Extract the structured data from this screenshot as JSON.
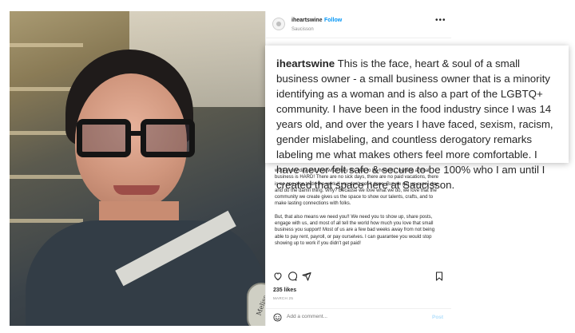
{
  "post": {
    "username": "iheartswine",
    "separator": "•",
    "follow_label": "Follow",
    "location": "Saucisson",
    "more_label": "•••",
    "badge_text": "Meliss"
  },
  "callout": {
    "username": "iheartswine",
    "text": "This is the face, heart & soul of a small business owner - a small business owner that is a minority identifying as a woman and is also a part of the LGBTQ+ community. I have been in the food industry since I was 14 years old, and over the years I have faced, sexism, racism, gender mislabeling, and countless derogatory remarks labeling me what makes others feel more comfortable. I have never felt safe & secure to be 100% who I am until I created that space here at Saucisson."
  },
  "caption": {
    "para1": "work every day and love what they do, but, to be honest... owning a small business is HARD! There are no sick days, there are no paid vacations, there is no one else to do the work if you don't get it done. But we get up every day and do the damn thing. Why? Because we love what we do, we love that the community we create gives us the space to show our talents, crafts, and to make lasting connections with folks.",
    "para2": "But, that also means we need you!! We need you to show up, share posts, engage with us, and most of all tell the world how much you love that small business you support! Most of us are a few bad weeks away from not being able to pay rent, payroll, or pay ourselves. I can guarantee you would stop showing up to work if you didn't get paid!"
  },
  "engagement": {
    "likes": "235 likes",
    "date": "MARCH 25"
  },
  "comment": {
    "placeholder": "Add a comment...",
    "post_label": "Post"
  },
  "icons": [
    "heart-icon",
    "comment-icon",
    "share-icon",
    "bookmark-icon",
    "emoji-icon"
  ],
  "colors": {
    "link": "#0095f6",
    "post_disabled": "#b2dffc",
    "text": "#262626",
    "muted": "#8e8e8e"
  }
}
